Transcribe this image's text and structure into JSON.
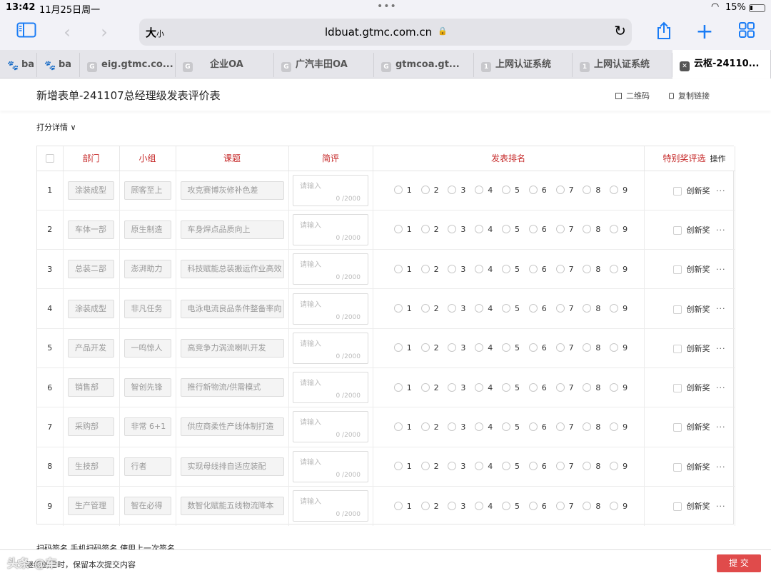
{
  "status_bar": {
    "time": "13:42",
    "date": "11月25日周一",
    "battery": "15%"
  },
  "browser": {
    "text_size": "大",
    "text_size_small": "小",
    "url": "ldbuat.gtmc.com.cn",
    "tabs": [
      {
        "label": "ba",
        "fav": "paw-icon"
      },
      {
        "label": "ba",
        "fav": "paw-icon"
      },
      {
        "label": "eig.gtmc.co...",
        "fav": "G"
      },
      {
        "label": "企业OA",
        "fav": "G"
      },
      {
        "label": "广汽丰田OA",
        "fav": "G"
      },
      {
        "label": "gtmcoa.gt...",
        "fav": "G"
      },
      {
        "label": "上网认证系统",
        "fav": "1"
      },
      {
        "label": "上网认证系统",
        "fav": "1"
      },
      {
        "label": "云枢-24110...",
        "fav": "close"
      }
    ]
  },
  "page": {
    "title": "新增表单-241107总经理级发表评价表",
    "qr_label": "二维码",
    "copy_link_label": "复制链接",
    "section_label": "打分详情 ∨"
  },
  "table": {
    "headers": {
      "dept": "部门",
      "group": "小组",
      "topic": "课题",
      "comment": "简评",
      "rank": "发表排名",
      "award": "特别奖评选",
      "ops": "操作"
    },
    "textarea_placeholder": "请输入",
    "textarea_count": "0 /2000",
    "rank_options": [
      "1",
      "2",
      "3",
      "4",
      "5",
      "6",
      "7",
      "8",
      "9"
    ],
    "award_label": "创新奖",
    "more_label": "···",
    "rows": [
      {
        "idx": "1",
        "dept": "涂装成型",
        "group": "顾客至上",
        "topic": "攻克赛博灰修补色差"
      },
      {
        "idx": "2",
        "dept": "车体一部",
        "group": "原生制造",
        "topic": "车身焊点品质向上"
      },
      {
        "idx": "3",
        "dept": "总装二部",
        "group": "澎湃助力",
        "topic": "科技赋能总装搬运作业高效"
      },
      {
        "idx": "4",
        "dept": "涂装成型",
        "group": "非凡任务",
        "topic": "电泳电流良品条件整备率向"
      },
      {
        "idx": "5",
        "dept": "产品开发",
        "group": "一鸣惊人",
        "topic": "高竞争力涡流喇叭开发"
      },
      {
        "idx": "6",
        "dept": "销售部",
        "group": "智创先锋",
        "topic": "推行新物流/供需模式"
      },
      {
        "idx": "7",
        "dept": "采购部",
        "group": "非常 6+1",
        "topic": "供应商柔性产线体制打造"
      },
      {
        "idx": "8",
        "dept": "生技部",
        "group": "行者",
        "topic": "实现母线排自适应装配"
      },
      {
        "idx": "9",
        "dept": "生产管理",
        "group": "智在必得",
        "topic": "数智化赋能五线物流降本"
      }
    ]
  },
  "footer": {
    "clipped_text": "扫码签名    手机扫码签名    使用上一次签名",
    "keep_label": "继续创建时，保留本次提交内容",
    "submit_label": "提 交",
    "watermark": "头条 @车"
  }
}
